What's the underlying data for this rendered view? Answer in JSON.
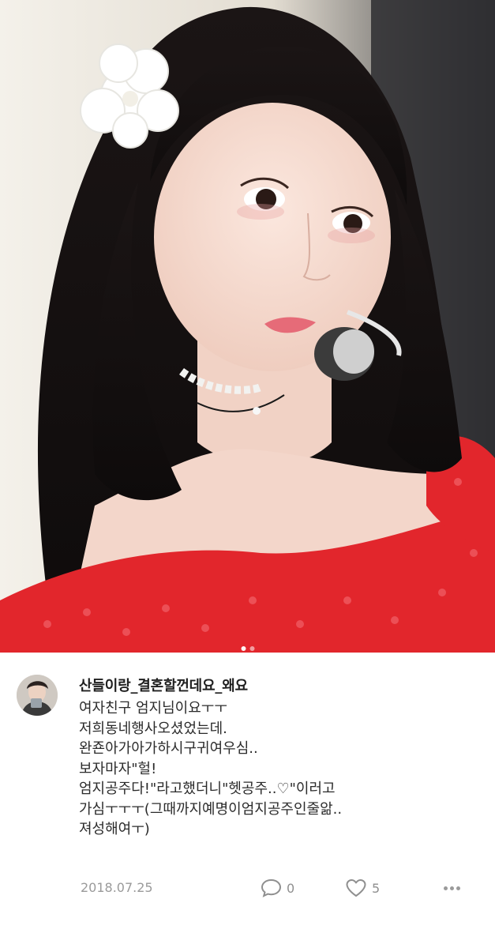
{
  "post": {
    "username": "산들이랑_결혼할껀데요_왜요",
    "body_lines": [
      "여자친구 엄지님이요ㅜㅜ",
      "저희동네행사오셨었는데.",
      "완죤아가아가하시구귀여우심..",
      "보자마자\"헐!",
      "엄지공주다!\"라고했더니\"헷공주..♡\"이러고",
      "가심ㅜㅜㅜ(그때까지예명이엄지공주인줄앎..",
      "져성해여ㅜ)"
    ],
    "date": "2018.07.25",
    "comment_count": "0",
    "like_count": "5"
  },
  "carousel": {
    "total_pages": 2,
    "current_page": 1
  },
  "icons": {
    "comment": "speech-bubble-icon",
    "like": "heart-icon",
    "more": "more-horizontal-icon"
  },
  "colors": {
    "meta_text": "#9a9a9a",
    "dress_red": "#e2262c"
  }
}
